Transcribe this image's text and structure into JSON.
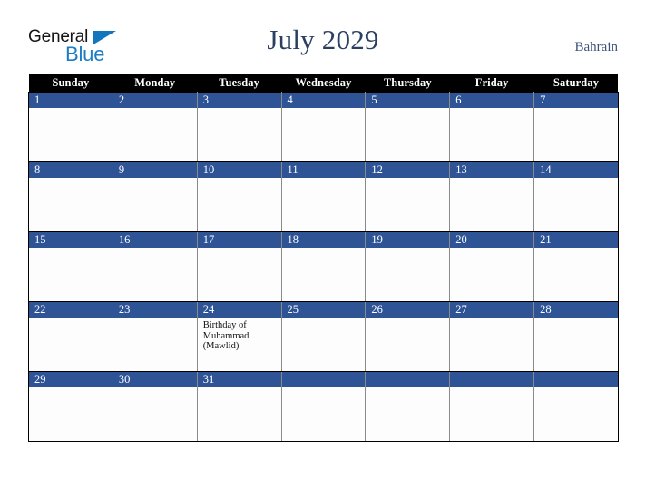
{
  "brand": {
    "name_part1": "General",
    "name_part2": "Blue",
    "triangle_icon": "triangle-icon",
    "color_dark": "#141414",
    "color_blue": "#1c7cc4"
  },
  "header": {
    "title": "July 2029",
    "country": "Bahrain",
    "title_color": "#2b3f61",
    "country_color": "#3b5278"
  },
  "calendar": {
    "month": "July",
    "year": "2029",
    "accent_color": "#2e5496",
    "header_bg": "#000000",
    "weekdays": [
      "Sunday",
      "Monday",
      "Tuesday",
      "Wednesday",
      "Thursday",
      "Friday",
      "Saturday"
    ],
    "weeks": [
      [
        {
          "day": "1",
          "events": []
        },
        {
          "day": "2",
          "events": []
        },
        {
          "day": "3",
          "events": []
        },
        {
          "day": "4",
          "events": []
        },
        {
          "day": "5",
          "events": []
        },
        {
          "day": "6",
          "events": []
        },
        {
          "day": "7",
          "events": []
        }
      ],
      [
        {
          "day": "8",
          "events": []
        },
        {
          "day": "9",
          "events": []
        },
        {
          "day": "10",
          "events": []
        },
        {
          "day": "11",
          "events": []
        },
        {
          "day": "12",
          "events": []
        },
        {
          "day": "13",
          "events": []
        },
        {
          "day": "14",
          "events": []
        }
      ],
      [
        {
          "day": "15",
          "events": []
        },
        {
          "day": "16",
          "events": []
        },
        {
          "day": "17",
          "events": []
        },
        {
          "day": "18",
          "events": []
        },
        {
          "day": "19",
          "events": []
        },
        {
          "day": "20",
          "events": []
        },
        {
          "day": "21",
          "events": []
        }
      ],
      [
        {
          "day": "22",
          "events": []
        },
        {
          "day": "23",
          "events": []
        },
        {
          "day": "24",
          "events": [
            "Birthday of Muhammad (Mawlid)"
          ]
        },
        {
          "day": "25",
          "events": []
        },
        {
          "day": "26",
          "events": []
        },
        {
          "day": "27",
          "events": []
        },
        {
          "day": "28",
          "events": []
        }
      ],
      [
        {
          "day": "29",
          "events": []
        },
        {
          "day": "30",
          "events": []
        },
        {
          "day": "31",
          "events": []
        },
        {
          "day": "",
          "events": []
        },
        {
          "day": "",
          "events": []
        },
        {
          "day": "",
          "events": []
        },
        {
          "day": "",
          "events": []
        }
      ]
    ]
  }
}
